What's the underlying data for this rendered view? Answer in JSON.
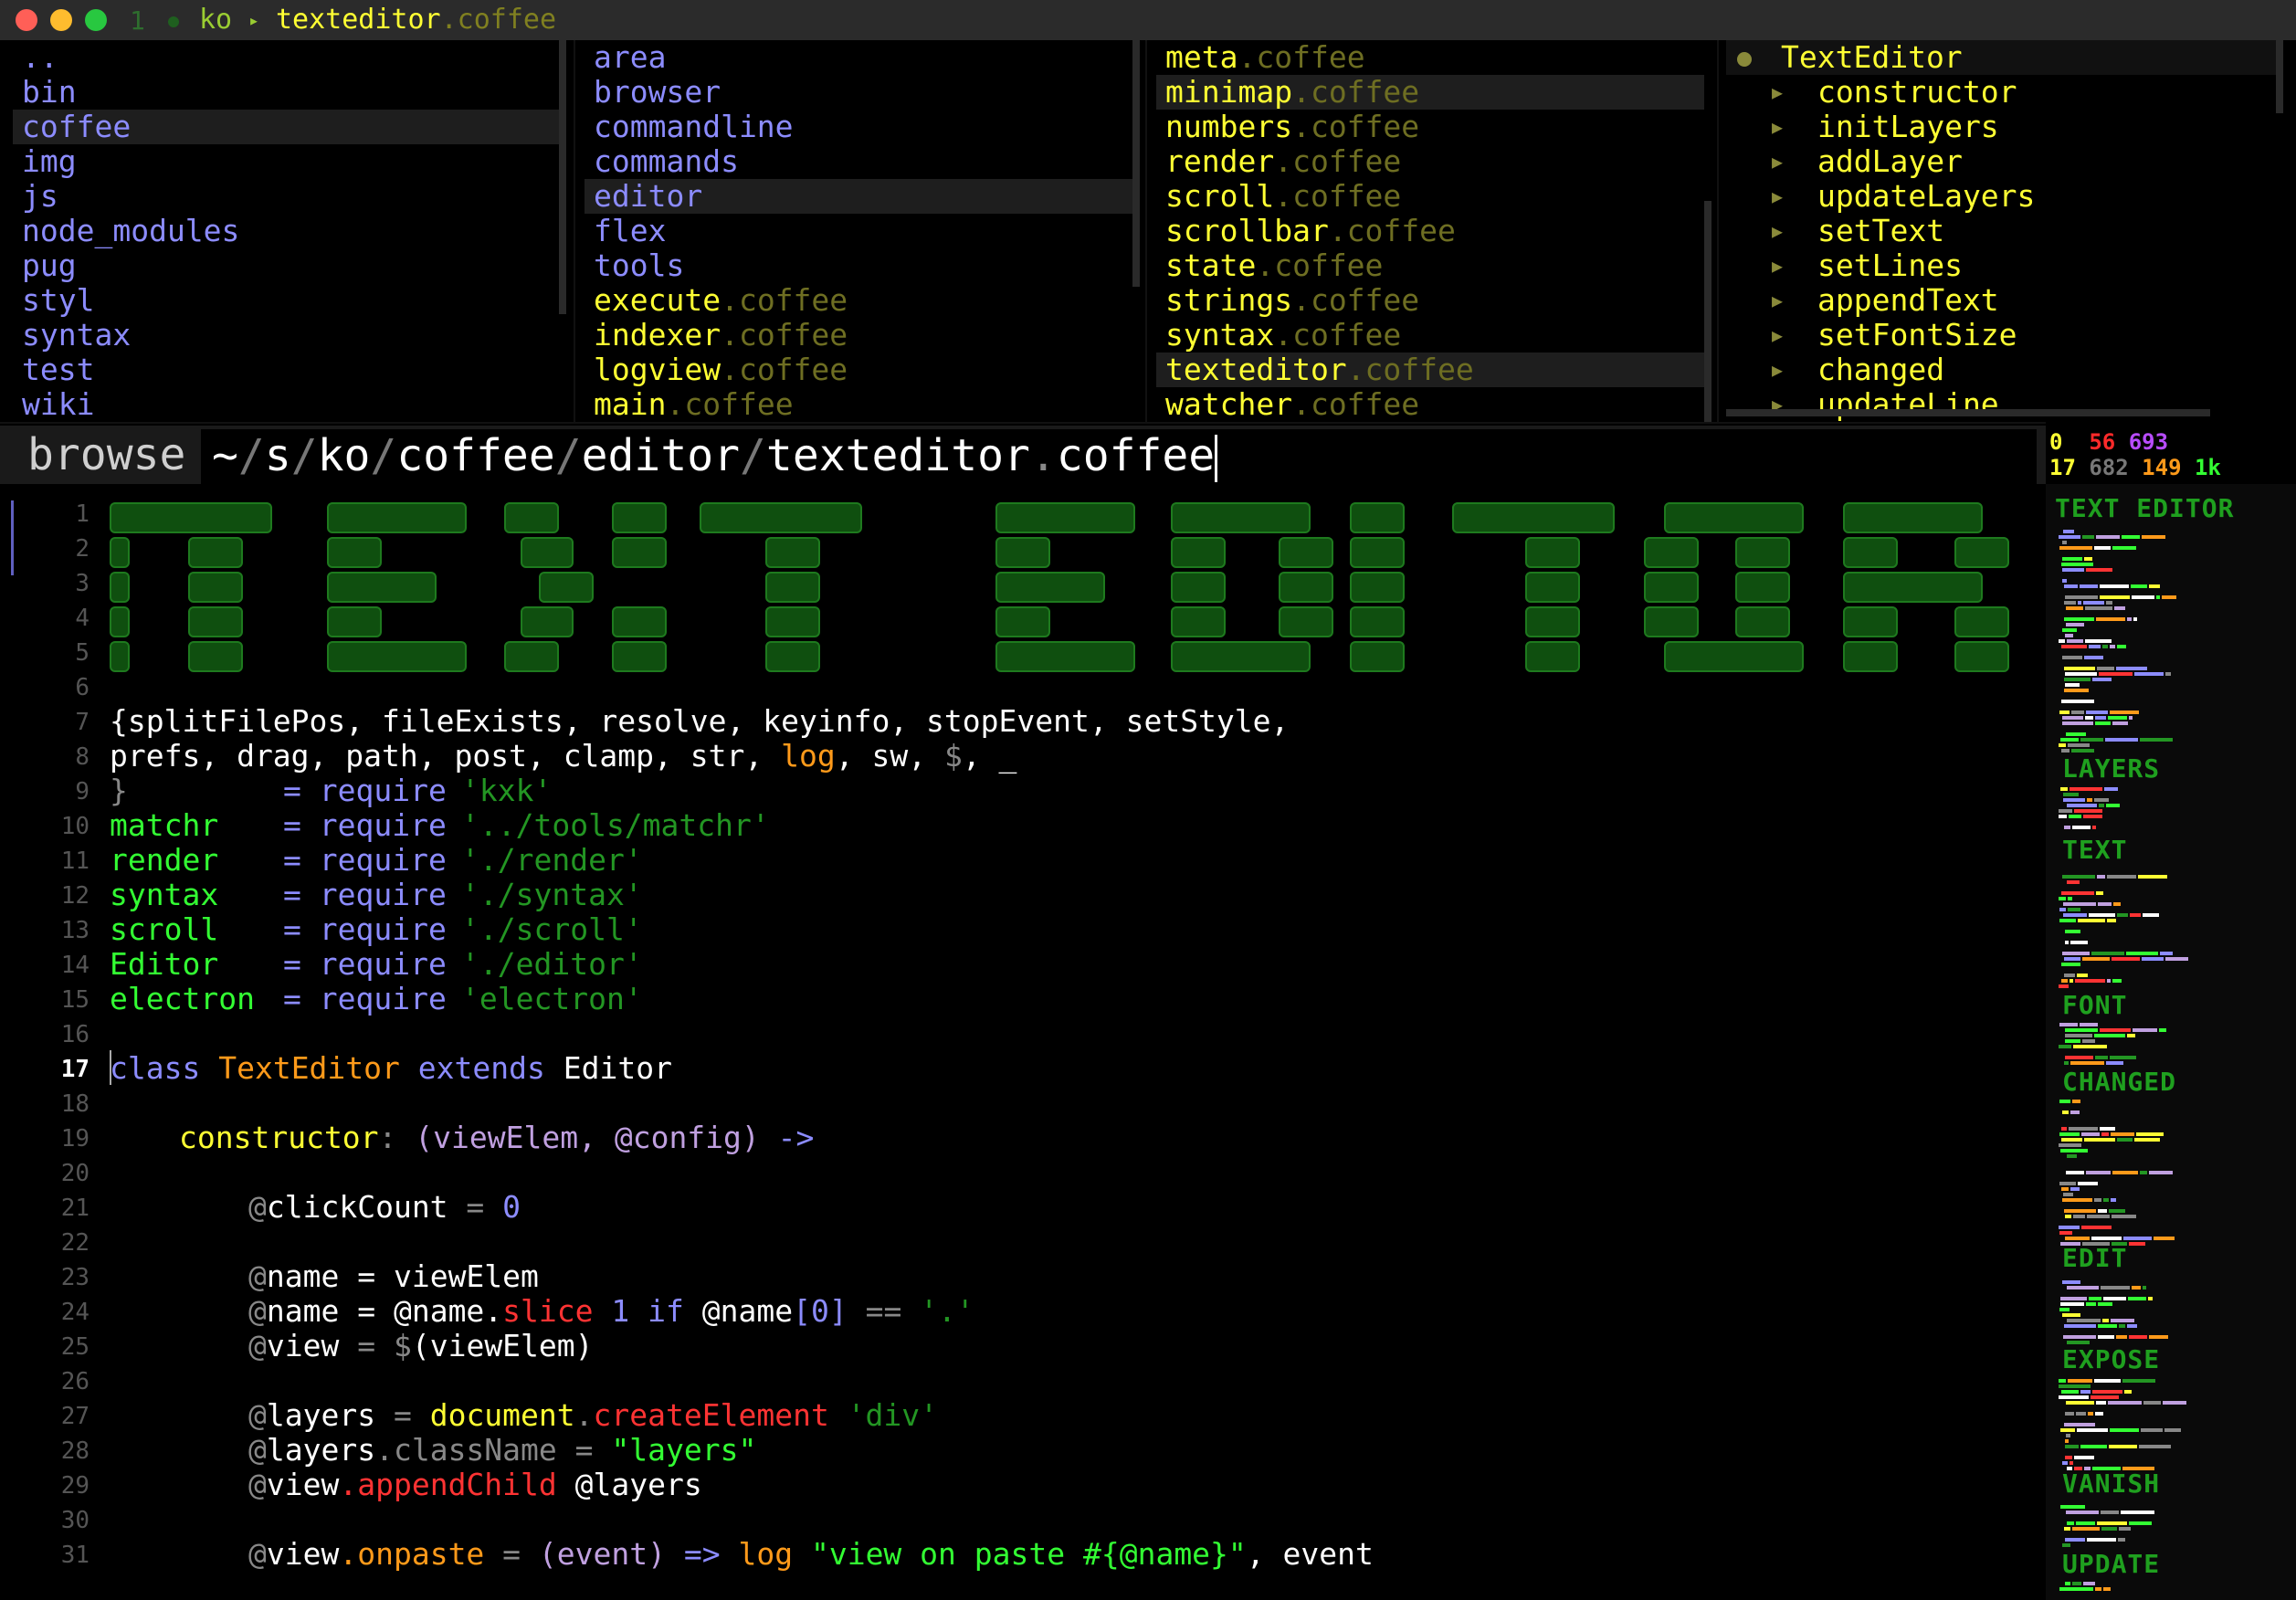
{
  "titlebar": {
    "number": "1",
    "project": "ko",
    "file_name": "texteditor",
    "file_ext": ".coffee"
  },
  "browser": {
    "col1": [
      {
        "label": "..",
        "selected": false
      },
      {
        "label": "bin",
        "selected": false
      },
      {
        "label": "coffee",
        "selected": true
      },
      {
        "label": "img",
        "selected": false
      },
      {
        "label": "js",
        "selected": false
      },
      {
        "label": "node_modules",
        "selected": false
      },
      {
        "label": "pug",
        "selected": false
      },
      {
        "label": "styl",
        "selected": false
      },
      {
        "label": "syntax",
        "selected": false
      },
      {
        "label": "test",
        "selected": false
      },
      {
        "label": "wiki",
        "selected": false
      }
    ],
    "col2_dirs": [
      "area",
      "browser",
      "commandline",
      "commands",
      "editor",
      "flex",
      "tools"
    ],
    "col2_selected": "editor",
    "col2_files": [
      {
        "name": "execute",
        "ext": ".coffee"
      },
      {
        "name": "indexer",
        "ext": ".coffee"
      },
      {
        "name": "logview",
        "ext": ".coffee"
      },
      {
        "name": "main",
        "ext": ".coffee"
      }
    ],
    "col3_files": [
      {
        "name": "meta",
        "ext": ".coffee",
        "selected": false
      },
      {
        "name": "minimap",
        "ext": ".coffee",
        "selected": true
      },
      {
        "name": "numbers",
        "ext": ".coffee",
        "selected": false
      },
      {
        "name": "render",
        "ext": ".coffee",
        "selected": false
      },
      {
        "name": "scroll",
        "ext": ".coffee",
        "selected": false
      },
      {
        "name": "scrollbar",
        "ext": ".coffee",
        "selected": false
      },
      {
        "name": "state",
        "ext": ".coffee",
        "selected": false
      },
      {
        "name": "strings",
        "ext": ".coffee",
        "selected": false
      },
      {
        "name": "syntax",
        "ext": ".coffee",
        "selected": false
      },
      {
        "name": "texteditor",
        "ext": ".coffee",
        "selected": true
      },
      {
        "name": "watcher",
        "ext": ".coffee",
        "selected": false
      }
    ],
    "col4": {
      "class_name": "TextEditor",
      "methods": [
        "constructor",
        "initLayers",
        "addLayer",
        "updateLayers",
        "setText",
        "setLines",
        "appendText",
        "setFontSize",
        "changed",
        "updateLine"
      ]
    }
  },
  "commandline": {
    "label": "browse",
    "path_parts": [
      "~",
      "s",
      "ko",
      "coffee",
      "editor",
      "texteditor"
    ],
    "path_ext": "coffee"
  },
  "stats": {
    "row1": [
      "0",
      "56",
      "693"
    ],
    "row2": [
      "17",
      "682",
      "149",
      "1k"
    ]
  },
  "editor": {
    "current_line": 17,
    "line_numbers": [
      "1",
      "2",
      "3",
      "4",
      "5",
      "6",
      "7",
      "8",
      "9",
      "10",
      "11",
      "12",
      "13",
      "14",
      "15",
      "16",
      "17",
      "18",
      "19",
      "20",
      "21",
      "22",
      "23",
      "24",
      "25",
      "26",
      "27",
      "28",
      "29",
      "30",
      "31"
    ],
    "code": {
      "l7_a": "{splitFilePos, fileExists, resolve, keyinfo, stopEvent, setStyle,",
      "l8_a": "prefs, drag, path, post, clamp, str, ",
      "l8_log": "log",
      "l8_b": ", sw, ",
      "l8_dollar": "$",
      "l8_c": ", _",
      "l9_a": "}",
      "req": "= require",
      "l9_str": "'kxk'",
      "l10_var": "matchr",
      "l10_str": "'../tools/matchr'",
      "l11_var": "render",
      "l11_str": "'./render'",
      "l12_var": "syntax",
      "l12_str": "'./syntax'",
      "l13_var": "scroll",
      "l13_str": "'./scroll'",
      "l14_var": "Editor",
      "l14_str": "'./editor'",
      "l15_var": "electron",
      "l15_str": "'electron'",
      "l17_class": "class",
      "l17_name": "TextEditor",
      "l17_extends": "extends",
      "l17_base": "Editor",
      "l19_name": "constructor",
      "l19_colon": ":",
      "l19_args": "(viewElem, @config)",
      "l19_arrow": "->",
      "l21_at": "@",
      "l21_var": "clickCount",
      "l21_eq": " = ",
      "l21_val": "0",
      "l23_var": "name",
      "l23_rest": " = viewElem",
      "l24_var": "name",
      "l24_eq": " = @name.",
      "l24_fn": "slice",
      "l24_num": " 1 ",
      "l24_if": "if",
      "l24_rest": " @name",
      "l24_idx": "[0]",
      "l24_cmp": " == ",
      "l24_str": "'.'",
      "l25_var": "view",
      "l25_eq": " = ",
      "l25_d": "$",
      "l25_rest": "(viewElem)",
      "l27_var": "layers",
      "l27_eq": " = ",
      "l27_doc": "document",
      "l27_dot": ".",
      "l27_fn": "createElement",
      "l27_str": " 'div'",
      "l28_var": "layers",
      "l28_prop": ".className",
      "l28_eq": " = ",
      "l28_str": "\"layers\"",
      "l29_var": "view",
      "l29_fn": ".appendChild",
      "l29_rest": " @layers",
      "l31_var": "view",
      "l31_prop": ".onpaste",
      "l31_eq": " = ",
      "l31_args": "(event)",
      "l31_arrow": " => ",
      "l31_log": "log",
      "l31_str": " \"view on paste #{@name}\"",
      "l31_rest": ", event"
    }
  },
  "minimap": {
    "labels": [
      "TEXT EDITOR",
      "LAYERS",
      "TEXT",
      "FONT",
      "CHANGED",
      "EDIT",
      "EXPOSE",
      "VANISH",
      "UPDATE"
    ]
  },
  "colors": {
    "accent_green": "#33ff33",
    "file_yellow": "#ffff33",
    "dir_blue": "#8c8cff",
    "ext_olive": "#6e6e22"
  }
}
